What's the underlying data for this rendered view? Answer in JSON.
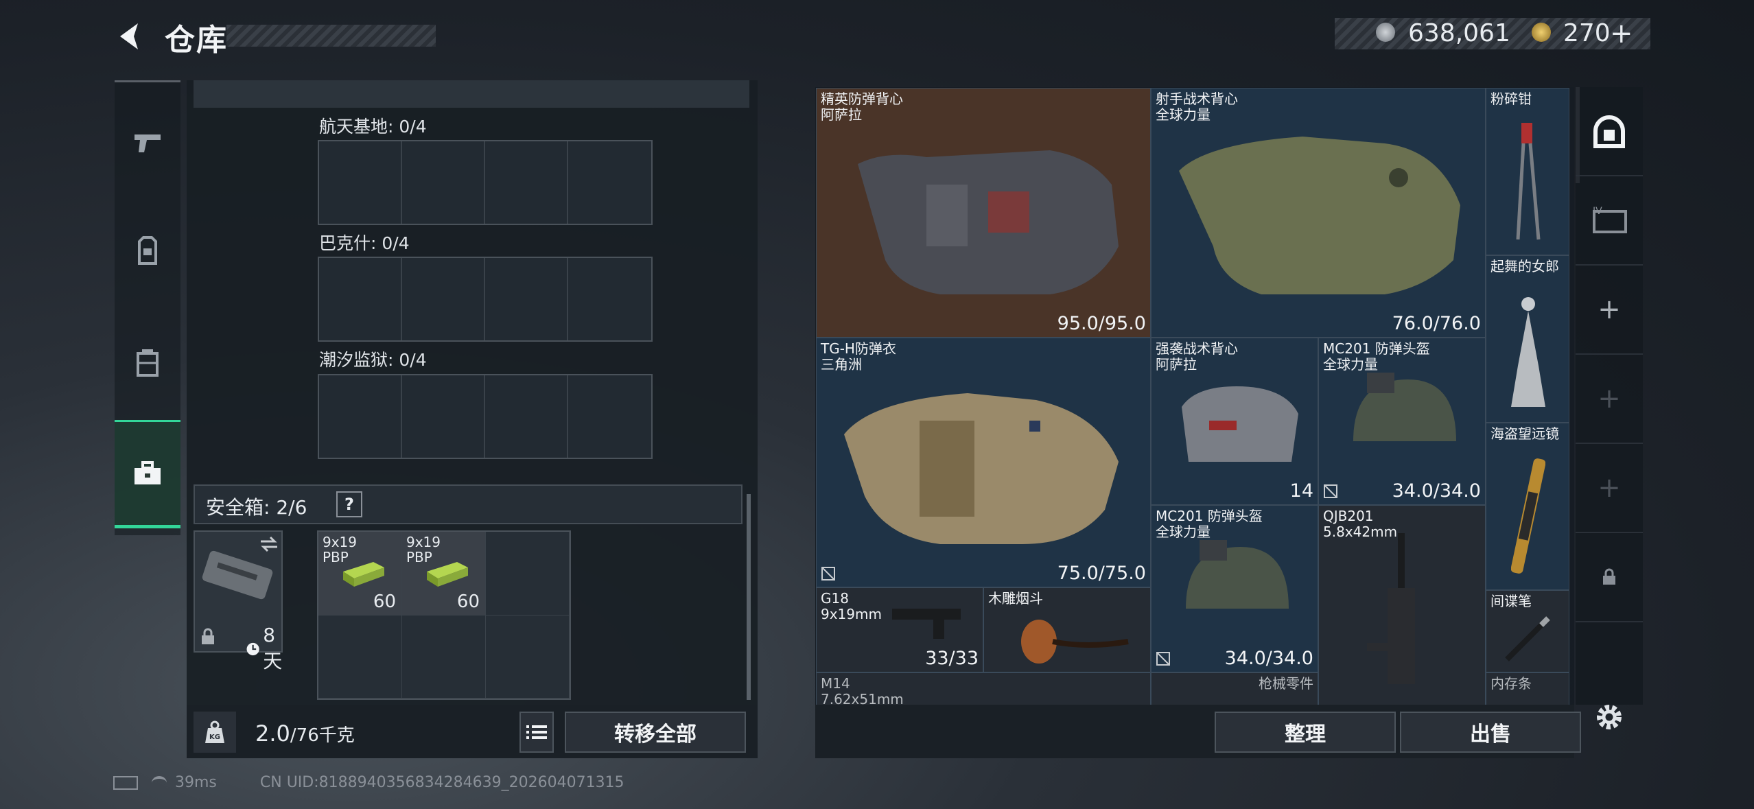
{
  "header": {
    "title": "仓库",
    "currency1": "638,061",
    "currency2": "270",
    "add_label": "+"
  },
  "left_panel": {
    "sections": [
      {
        "label": "航天基地: 0/4"
      },
      {
        "label": "巴克什: 0/4"
      },
      {
        "label": "潮汐监狱: 0/4"
      }
    ],
    "safebox": {
      "label": "安全箱: 2/6",
      "help": "?",
      "duration": "8天",
      "ammo": [
        {
          "name": "9x19\nPBP",
          "count": "60"
        },
        {
          "name": "9x19\nPBP",
          "count": "60"
        }
      ]
    },
    "weight": {
      "current": "2.0",
      "max": "/76千克",
      "unit_icon": "KG"
    },
    "transfer_all": "转移全部"
  },
  "stash": {
    "items": [
      {
        "name": "精英防弹背心\n阿萨拉",
        "value": "95.0/95.0"
      },
      {
        "name": "射手战术背心\n全球力量",
        "value": "76.0/76.0"
      },
      {
        "name": "粉碎钳",
        "value": ""
      },
      {
        "name": "起舞的女郎",
        "value": ""
      },
      {
        "name": "TG-H防弹衣\n三角洲",
        "value": "75.0/75.0"
      },
      {
        "name": "强袭战术背心\n阿萨拉",
        "value": "14"
      },
      {
        "name": "MC201 防弹头盔\n全球力量",
        "value": "34.0/34.0"
      },
      {
        "name": "海盗望远镜",
        "value": ""
      },
      {
        "name": "MC201 防弹头盔\n全球力量",
        "value": "34.0/34.0"
      },
      {
        "name": "QJB201\n5.8x42mm",
        "value": ""
      },
      {
        "name": "G18\n9x19mm",
        "value": "33/33"
      },
      {
        "name": "木雕烟斗",
        "value": ""
      },
      {
        "name": "间谍笔",
        "value": ""
      },
      {
        "name": "M14\n7.62x51mm",
        "value": ""
      },
      {
        "name": "枪械零件",
        "value": ""
      },
      {
        "name": "内存条",
        "value": ""
      }
    ],
    "sort_label": "整理",
    "sell_label": "出售"
  },
  "right_column": {
    "slots": [
      "stash-1",
      "stash-2",
      "+",
      "+",
      "+",
      "lock"
    ]
  },
  "status_bar": {
    "ping": "39ms",
    "uid": "CN UID:8188940356834284639_202604071315"
  },
  "colors": {
    "accent": "#33d699",
    "item_bg_blue": "#1f3346",
    "item_bg_orange": "#4a3428"
  }
}
